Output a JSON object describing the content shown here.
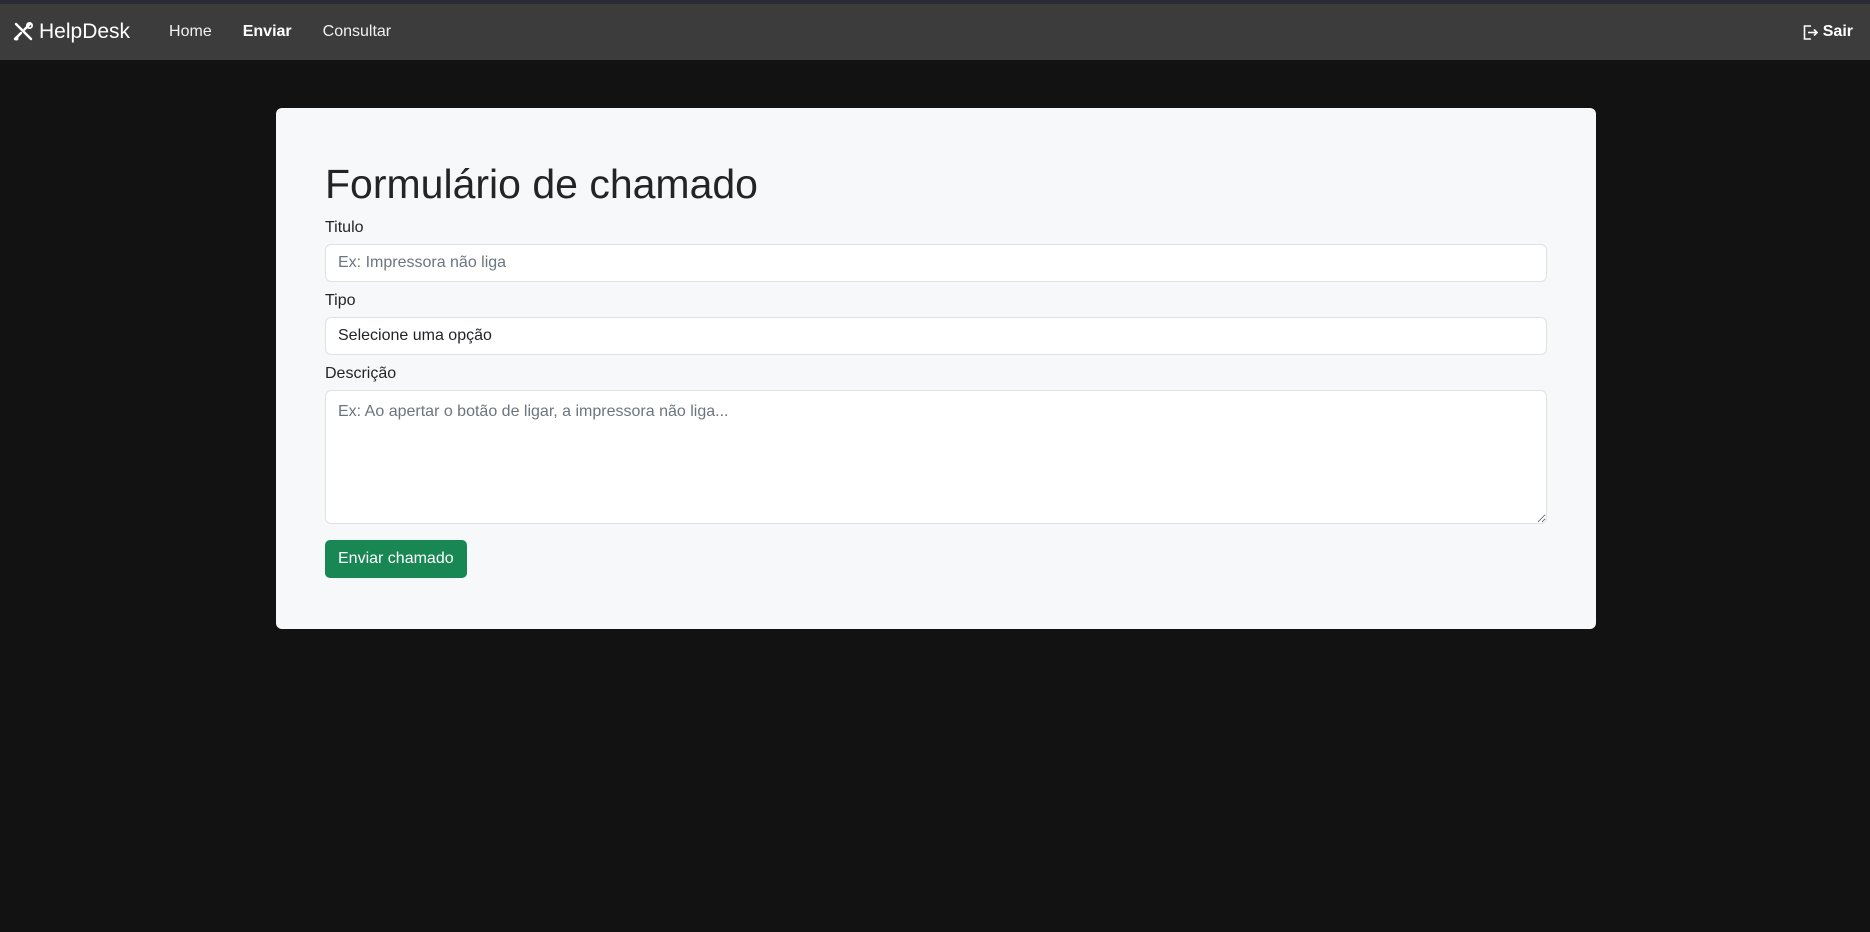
{
  "navbar": {
    "brand": "HelpDesk",
    "brand_icon": "tools-icon",
    "links": [
      {
        "label": "Home"
      },
      {
        "label": "Enviar"
      },
      {
        "label": "Consultar"
      }
    ],
    "active_link": "Enviar",
    "logout_label": "Sair",
    "logout_icon": "logout-icon"
  },
  "form": {
    "title": "Formulário de chamado",
    "titulo_label": "Titulo",
    "titulo_placeholder": "Ex: Impressora não liga",
    "tipo_label": "Tipo",
    "tipo_value": "Selecione uma opção",
    "descricao_label": "Descrição",
    "descricao_placeholder": "Ex: Ao apertar o botão de ligar, a impressora não liga...",
    "submit_label": "Enviar chamado"
  },
  "colors": {
    "background": "#121212",
    "navbar": "#3c3c3c",
    "card": "#f7f8f9",
    "submit": "#198754"
  }
}
